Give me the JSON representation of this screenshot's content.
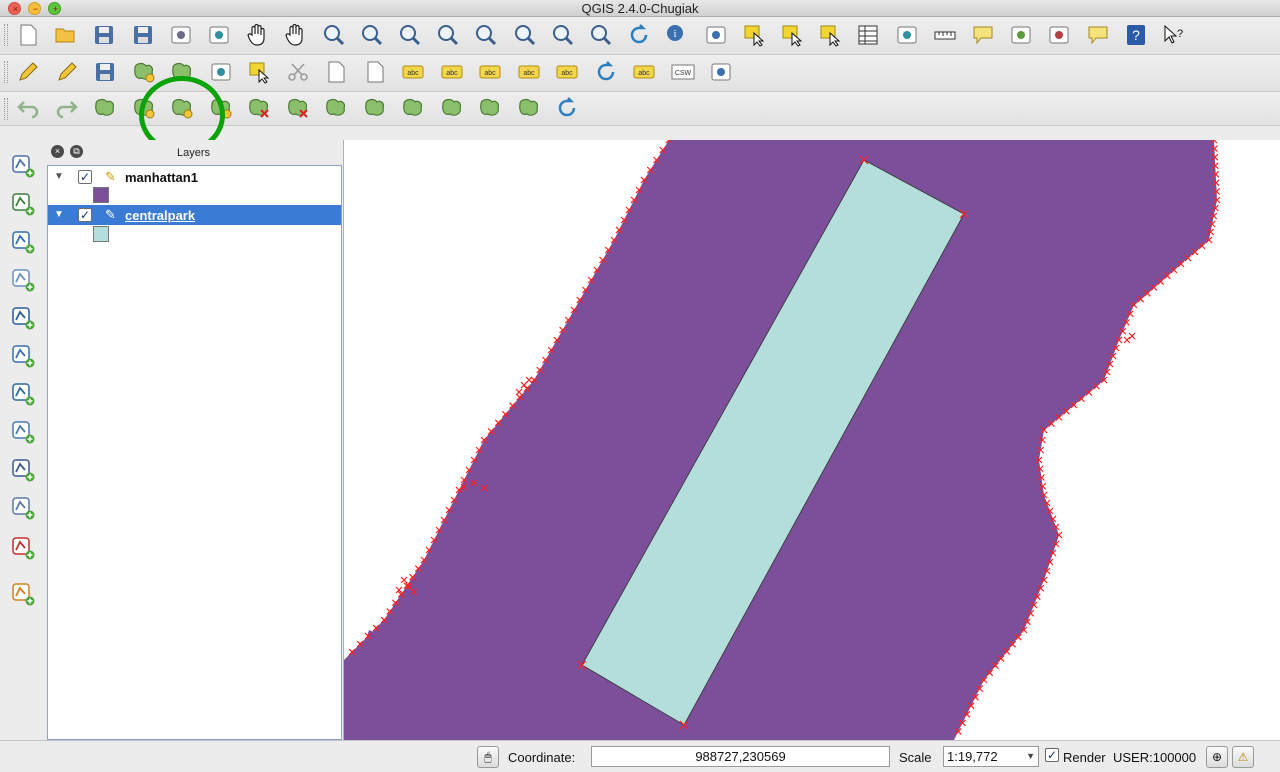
{
  "window": {
    "title": "QGIS 2.4.0-Chugiak",
    "close_glyph": "×",
    "minimize_glyph": "−",
    "zoom_glyph": "+"
  },
  "toolbar1": [
    "new-project-icon",
    "open-project-icon",
    "save-project-icon",
    "save-project-as-icon",
    "new-print-composer-icon",
    "composer-manager-icon",
    "pan-map-icon",
    "pan-to-selection-icon",
    "zoom-in-icon",
    "zoom-out-icon",
    "zoom-actual-size-icon",
    "zoom-full-icon",
    "zoom-to-selection-icon",
    "zoom-to-layer-icon",
    "zoom-last-icon",
    "zoom-next-icon",
    "refresh-icon",
    "identify-icon",
    "run-action-icon",
    "select-features-icon",
    "deselect-icon",
    "select-by-expression-icon",
    "attribute-table-icon",
    "field-calculator-icon",
    "measure-icon",
    "map-tips-icon",
    "new-bookmark-icon",
    "show-bookmarks-icon",
    "text-annotation-icon",
    "help-contents-icon",
    "whats-this-icon"
  ],
  "toolbar2": {
    "icons": [
      "current-edits-icon",
      "toggle-editing-icon",
      "save-layer-edits-icon",
      "add-feature-icon",
      "move-feature-icon",
      "node-tool-icon",
      "delete-selected-icon",
      "cut-features-icon",
      "copy-features-icon",
      "paste-features-icon",
      "label-tool-icon",
      "pin-labels-icon",
      "highlight-pinned-icon",
      "show-hide-labels-icon",
      "move-label-icon",
      "rotate-label-icon",
      "change-label-icon",
      "csw-icon",
      "digitize-plugin-icon"
    ],
    "label_text": "abc",
    "csw_text": "CSW"
  },
  "toolbar3": [
    "undo-icon",
    "redo-icon",
    "simplify-feature-icon",
    "add-ring-icon",
    "add-part-icon",
    "fill-ring-icon",
    "delete-ring-icon",
    "delete-part-icon",
    "offset-curve-icon",
    "reshape-features-icon",
    "split-features-icon",
    "split-parts-icon",
    "merge-selected-icon",
    "merge-attributes-icon",
    "rotate-point-symbols-icon"
  ],
  "left_toolbar": [
    "add-vector-layer-icon",
    "add-raster-layer-icon",
    "add-postgis-layer-icon",
    "add-spatialite-layer-icon",
    "add-mssql-layer-icon",
    "add-wms-layer-icon",
    "add-wcs-layer-icon",
    "add-wfs-layer-icon",
    "add-delimited-text-layer-icon",
    "new-shapefile-layer-icon",
    "remove-layer-icon",
    "new-gpx-layer-icon"
  ],
  "layers_panel": {
    "title": "Layers",
    "close_glyph": "×",
    "float_glyph": "⧉",
    "expand_glyph": "▼",
    "check_glyph": "✓",
    "pencil_glyph": "✎",
    "layers": [
      {
        "name": "manhattan1",
        "checked": true,
        "editing": true,
        "color": "#7b4f9a",
        "selected": false
      },
      {
        "name": "centralpark",
        "checked": true,
        "editing": true,
        "color": "#b4dedb",
        "selected": true
      }
    ]
  },
  "map": {
    "manhattan_fill": "#7b4f9a",
    "park_fill": "#b4dedb",
    "vertex_marker_color": "#ff2020"
  },
  "statusbar": {
    "coordinate_label": "Coordinate:",
    "coordinate_value": "988727,230569",
    "scale_label": "Scale",
    "scale_value": "1:19,772",
    "render_checked": true,
    "render_label": "Render",
    "crs_label": "USER:100000",
    "toggle_extents_icon": "mouse-icon",
    "crs_icon": "crs-icon",
    "messages_icon": "warning-icon"
  }
}
